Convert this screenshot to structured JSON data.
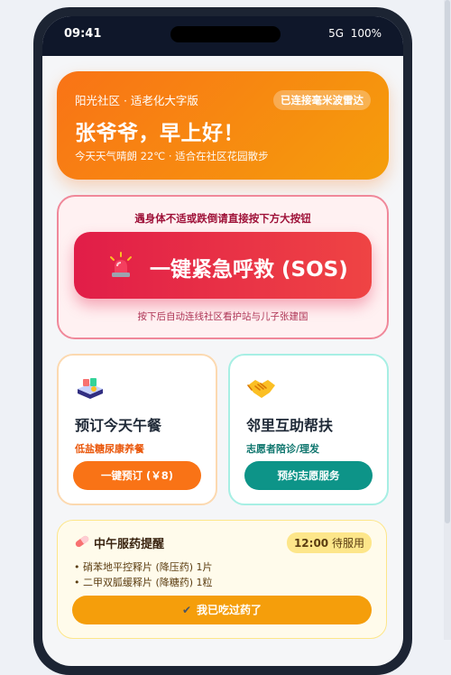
{
  "status_bar": {
    "time": "09:41",
    "network": "5G",
    "battery": "100%"
  },
  "greeting": {
    "community": "阳光社区 · 适老化大字版",
    "radar_badge": "已连接毫米波雷达",
    "title": "张爷爷，早上好！",
    "weather": "今天天气晴朗 22℃ · 适合在社区花园散步"
  },
  "sos": {
    "hint": "遇身体不适或跌倒请直接按下方大按钮",
    "button_label": "一键紧急呼救 (SOS)",
    "sub": "按下后自动连线社区看护站与儿子张建国",
    "icon": "siren-icon"
  },
  "services": [
    {
      "icon": "meal-tray-icon",
      "title": "预订今天午餐",
      "tag": "低盐糖尿康养餐",
      "button": "一键预订 (￥8)"
    },
    {
      "icon": "handshake-icon",
      "title": "邻里互助帮扶",
      "tag": "志愿者陪诊/理发",
      "button": "预约志愿服务"
    }
  ],
  "medication": {
    "icon": "pill-icon",
    "title": "中午服药提醒",
    "time": "12:00",
    "time_suffix": "待服用",
    "items": [
      "• 硝苯地平控释片 (降压药) 1片",
      "• 二甲双胍缓释片 (降糖药) 1粒"
    ],
    "done_button": "我已吃过药了"
  },
  "colors": {
    "accent_orange": "#f97316",
    "sos_red": "#e11d48",
    "teal": "#0d9488",
    "amber": "#f59e0b"
  }
}
